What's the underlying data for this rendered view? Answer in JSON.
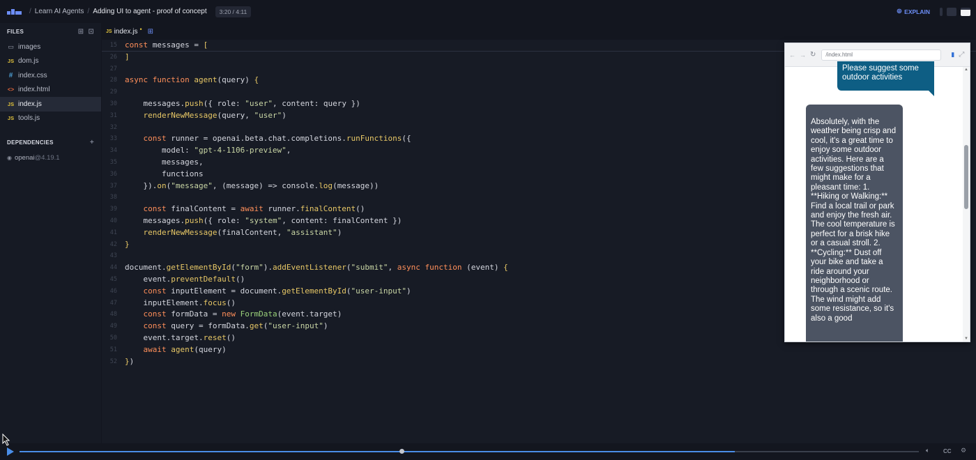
{
  "header": {
    "breadcrumb": [
      "Learn AI Agents",
      "Adding UI to agent - proof of concept"
    ],
    "time": "3:20 / 4:11",
    "explain_label": "EXPLAIN"
  },
  "sidebar": {
    "files_title": "FILES",
    "files": [
      {
        "name": "images",
        "icon": "folder-icon"
      },
      {
        "name": "dom.js",
        "icon": "JS"
      },
      {
        "name": "index.css",
        "icon": "#"
      },
      {
        "name": "index.html",
        "icon": "<>"
      },
      {
        "name": "index.js",
        "icon": "JS",
        "active": true
      },
      {
        "name": "tools.js",
        "icon": "JS"
      }
    ],
    "deps_title": "DEPENDENCIES",
    "dependency_name": "openai",
    "dependency_version": "@4.19.1"
  },
  "editor": {
    "tab_label": "index.js",
    "tab_badge": "JS",
    "lines": [
      {
        "n": "15",
        "t": [
          [
            "kw",
            "const "
          ],
          [
            "id",
            "messages "
          ],
          [
            "pn",
            "= "
          ],
          [
            "fn",
            "["
          ]
        ]
      },
      {
        "n": "26",
        "t": [
          [
            "fn",
            "]"
          ]
        ]
      },
      {
        "n": "27",
        "t": []
      },
      {
        "n": "28",
        "t": [
          [
            "kw",
            "async function "
          ],
          [
            "fn",
            "agent"
          ],
          [
            "pn",
            "("
          ],
          [
            "id",
            "query"
          ],
          [
            "pn",
            ") "
          ],
          [
            "fn",
            "{"
          ]
        ]
      },
      {
        "n": "29",
        "t": []
      },
      {
        "n": "30",
        "t": [
          [
            "id",
            "    messages."
          ],
          [
            "fn",
            "push"
          ],
          [
            "pn",
            "({ "
          ],
          [
            "id",
            "role"
          ],
          [
            "pn",
            ": "
          ],
          [
            "str",
            "\"user\""
          ],
          [
            "pn",
            ", "
          ],
          [
            "id",
            "content"
          ],
          [
            "pn",
            ": "
          ],
          [
            "id",
            "query "
          ],
          [
            "pn",
            "})"
          ]
        ]
      },
      {
        "n": "31",
        "t": [
          [
            "id",
            "    "
          ],
          [
            "fn",
            "renderNewMessage"
          ],
          [
            "pn",
            "("
          ],
          [
            "id",
            "query"
          ],
          [
            "pn",
            ", "
          ],
          [
            "str",
            "\"user\""
          ],
          [
            "pn",
            ")"
          ]
        ]
      },
      {
        "n": "32",
        "t": []
      },
      {
        "n": "33",
        "t": [
          [
            "kw",
            "    const "
          ],
          [
            "id",
            "runner "
          ],
          [
            "pn",
            "= "
          ],
          [
            "id",
            "openai.beta.chat.completions."
          ],
          [
            "fn",
            "runFunctions"
          ],
          [
            "pn",
            "({"
          ]
        ]
      },
      {
        "n": "34",
        "t": [
          [
            "id",
            "        model"
          ],
          [
            "pn",
            ": "
          ],
          [
            "str",
            "\"gpt-4-1106-preview\""
          ],
          [
            "pn",
            ","
          ]
        ]
      },
      {
        "n": "35",
        "t": [
          [
            "id",
            "        messages"
          ],
          [
            "pn",
            ","
          ]
        ]
      },
      {
        "n": "36",
        "t": [
          [
            "id",
            "        functions"
          ]
        ]
      },
      {
        "n": "37",
        "t": [
          [
            "pn",
            "    })."
          ],
          [
            "fn",
            "on"
          ],
          [
            "pn",
            "("
          ],
          [
            "str",
            "\"message\""
          ],
          [
            "pn",
            ", ("
          ],
          [
            "id",
            "message"
          ],
          [
            "pn",
            ") => "
          ],
          [
            "id",
            "console."
          ],
          [
            "fn",
            "log"
          ],
          [
            "pn",
            "("
          ],
          [
            "id",
            "message"
          ],
          [
            "pn",
            "))"
          ]
        ]
      },
      {
        "n": "38",
        "t": []
      },
      {
        "n": "39",
        "t": [
          [
            "kw",
            "    const "
          ],
          [
            "id",
            "finalContent "
          ],
          [
            "pn",
            "= "
          ],
          [
            "kw",
            "await "
          ],
          [
            "id",
            "runner."
          ],
          [
            "fn",
            "finalContent"
          ],
          [
            "pn",
            "()"
          ]
        ]
      },
      {
        "n": "40",
        "t": [
          [
            "id",
            "    messages."
          ],
          [
            "fn",
            "push"
          ],
          [
            "pn",
            "({ "
          ],
          [
            "id",
            "role"
          ],
          [
            "pn",
            ": "
          ],
          [
            "str",
            "\"system\""
          ],
          [
            "pn",
            ", "
          ],
          [
            "id",
            "content"
          ],
          [
            "pn",
            ": "
          ],
          [
            "id",
            "finalContent "
          ],
          [
            "pn",
            "})"
          ]
        ]
      },
      {
        "n": "41",
        "t": [
          [
            "id",
            "    "
          ],
          [
            "fn",
            "renderNewMessage"
          ],
          [
            "pn",
            "("
          ],
          [
            "id",
            "finalContent"
          ],
          [
            "pn",
            ", "
          ],
          [
            "str",
            "\"assistant\""
          ],
          [
            "pn",
            ")"
          ]
        ]
      },
      {
        "n": "42",
        "t": [
          [
            "fn",
            "}"
          ]
        ]
      },
      {
        "n": "43",
        "t": []
      },
      {
        "n": "44",
        "t": [
          [
            "id",
            "document."
          ],
          [
            "fn",
            "getElementById"
          ],
          [
            "pn",
            "("
          ],
          [
            "str",
            "\"form\""
          ],
          [
            "pn",
            ")."
          ],
          [
            "fn",
            "addEventListener"
          ],
          [
            "pn",
            "("
          ],
          [
            "str",
            "\"submit\""
          ],
          [
            "pn",
            ", "
          ],
          [
            "kw",
            "async function "
          ],
          [
            "pn",
            "("
          ],
          [
            "id",
            "event"
          ],
          [
            "pn",
            ") "
          ],
          [
            "fn",
            "{"
          ]
        ]
      },
      {
        "n": "45",
        "t": [
          [
            "id",
            "    event."
          ],
          [
            "fn",
            "preventDefault"
          ],
          [
            "pn",
            "()"
          ]
        ]
      },
      {
        "n": "46",
        "t": [
          [
            "kw",
            "    const "
          ],
          [
            "id",
            "inputElement "
          ],
          [
            "pn",
            "= "
          ],
          [
            "id",
            "document."
          ],
          [
            "fn",
            "getElementById"
          ],
          [
            "pn",
            "("
          ],
          [
            "str",
            "\"user-input\""
          ],
          [
            "pn",
            ")"
          ]
        ]
      },
      {
        "n": "47",
        "t": [
          [
            "id",
            "    inputElement."
          ],
          [
            "fn",
            "focus"
          ],
          [
            "pn",
            "()"
          ]
        ]
      },
      {
        "n": "48",
        "t": [
          [
            "kw",
            "    const "
          ],
          [
            "id",
            "formData "
          ],
          [
            "pn",
            "= "
          ],
          [
            "kw",
            "new "
          ],
          [
            "cls",
            "FormData"
          ],
          [
            "pn",
            "("
          ],
          [
            "id",
            "event.target"
          ],
          [
            "pn",
            ")"
          ]
        ]
      },
      {
        "n": "49",
        "t": [
          [
            "kw",
            "    const "
          ],
          [
            "id",
            "query "
          ],
          [
            "pn",
            "= "
          ],
          [
            "id",
            "formData."
          ],
          [
            "fn",
            "get"
          ],
          [
            "pn",
            "("
          ],
          [
            "str",
            "\"user-input\""
          ],
          [
            "pn",
            ")"
          ]
        ]
      },
      {
        "n": "50",
        "t": [
          [
            "id",
            "    event.target."
          ],
          [
            "fn",
            "reset"
          ],
          [
            "pn",
            "()"
          ]
        ]
      },
      {
        "n": "51",
        "t": [
          [
            "kw",
            "    await "
          ],
          [
            "fn",
            "agent"
          ],
          [
            "pn",
            "("
          ],
          [
            "id",
            "query"
          ],
          [
            "pn",
            ")"
          ]
        ]
      },
      {
        "n": "52",
        "t": [
          [
            "fn",
            "}"
          ],
          [
            "pn",
            ")"
          ]
        ]
      }
    ]
  },
  "preview": {
    "url": "/index.html",
    "user_message": "Please suggest some outdoor activities",
    "ai_message": "Absolutely, with the weather being crisp and cool, it's a great time to enjoy some outdoor activities. Here are a few suggestions that might make for a pleasant time: 1. **Hiking or Walking:** Find a local trail or park and enjoy the fresh air. The cool temperature is perfect for a brisk hike or a casual stroll. 2. **Cycling:** Dust off your bike and take a ride around your neighborhood or through a scenic route. The wind might add some resistance, so it's also a good"
  },
  "player": {
    "progress": 0.795,
    "cc_label": "CC"
  },
  "colors": {
    "accent": "#4a8ee8",
    "user_bubble": "#0e5e84",
    "ai_bubble": "#4c5463"
  }
}
